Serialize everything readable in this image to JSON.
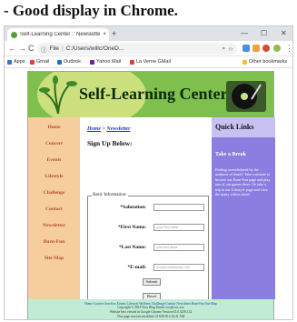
{
  "caption": "- Good display in Chrome.",
  "browser": {
    "tab_title": "Self-Learning Center :: Newsletter",
    "tab_close": "×",
    "new_tab": "+",
    "window_controls": [
      "—",
      "☐",
      "✕"
    ],
    "nav": {
      "back": "←",
      "forward": "→",
      "reload": "C"
    },
    "address": {
      "security": "File",
      "url": "C:/Users/willc/OneD..."
    },
    "bookmarks": [
      {
        "label": "Apps",
        "color": "#3b6fd0"
      },
      {
        "label": "Gmail",
        "color": "#d44638"
      },
      {
        "label": "Outlook",
        "color": "#1f6fc5"
      },
      {
        "label": "Yahoo Mail",
        "color": "#6a23a0"
      },
      {
        "label": "La Verne GMail",
        "color": "#d44638"
      }
    ],
    "other_bookmarks": "Other bookmarks"
  },
  "site": {
    "banner_title": "Self-Learning Center",
    "nav": [
      "Home",
      "Concert",
      "Events",
      "Lifestyle",
      "Challenge",
      "Contact",
      "Newsletter",
      "Burn-Fun",
      "Site Map"
    ],
    "breadcrumb": {
      "home": "Home",
      "separator": " > ",
      "current": "Newsletter"
    },
    "heading": "Sign Up Below:",
    "form": {
      "legend": "Basic Information:",
      "fields": [
        {
          "label": "*Salutation:",
          "placeholder": ""
        },
        {
          "label": "*First Name:",
          "placeholder": "your first name"
        },
        {
          "label": "*Last Name:",
          "placeholder": "your last name"
        },
        {
          "label": "*E-mail:",
          "placeholder": "you@yourdomain.com"
        }
      ],
      "submit": "Submit",
      "reset": "Reset"
    },
    "sidebar": {
      "title": "Quick Links",
      "subtitle": "Take a Break",
      "blurb": "Feeling overwhelmed by the madness of finals? Take a minute to browse our Burn-Fun page and play one of our games there. Or take a trip to our Lifestyle page and view the many videos there!"
    },
    "footer": {
      "links": "Home Concert Aerobics Events Lifestyle Wellness Challenge Contact Newsletter Burn-Fun Site Map",
      "copyright": "Copyright © 2018 Your Blog Email: xxx@xxx.xxx",
      "validated": "Website best viewed in Google Chrome Version 63.0.3239.132",
      "modified": "This page was last modified 2/18/2018 2:16:41 AM"
    },
    "colors": {
      "banner": "#7fbf4d",
      "nav": "#f6ce9e",
      "sidebar": "#8a7ee0",
      "footer": "#bfecd3"
    }
  }
}
